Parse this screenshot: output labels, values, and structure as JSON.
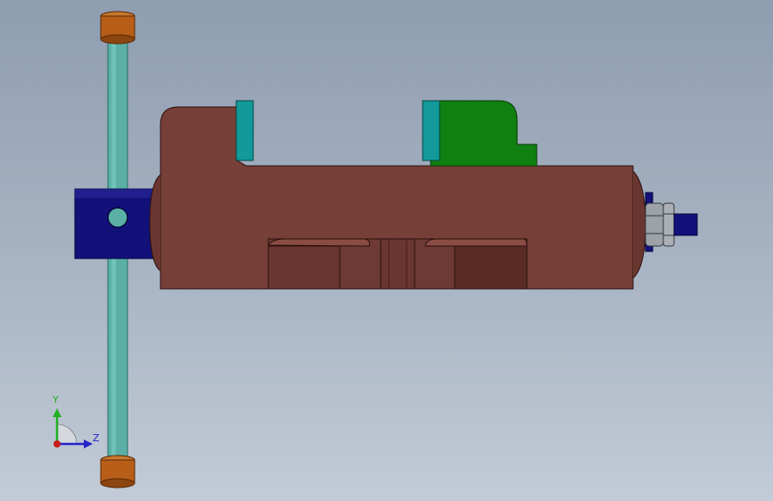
{
  "viewport": {
    "background_top": "#8e9db0",
    "background_bottom": "#c2cbd6"
  },
  "model": {
    "body_color": "#763f37",
    "body_dark_color": "#5a2a25",
    "jaw_color": "#129a9a",
    "moving_jaw_color": "#108010",
    "spindle_color": "#12117a",
    "handle_rod_color": "#5ab0a6",
    "handle_cap_color": "#b85e18",
    "nut_color": "#9ca2a8"
  },
  "triad": {
    "y_label": "Y",
    "z_label": "Z",
    "y_color": "#21b021",
    "z_color": "#2424c8",
    "origin_color": "#c81e1e"
  }
}
